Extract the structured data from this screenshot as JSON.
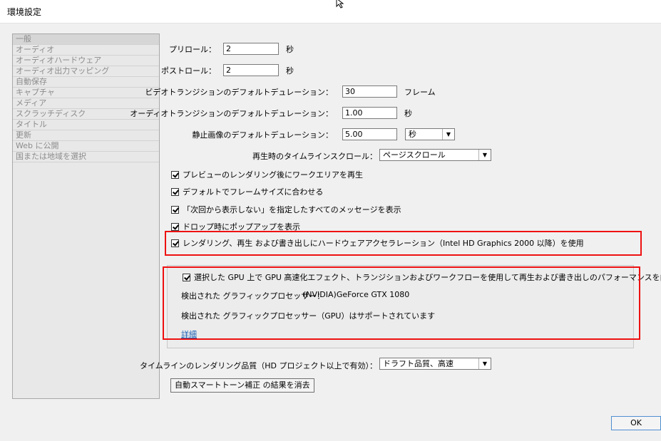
{
  "window": {
    "title": "環境設定"
  },
  "sidebar": {
    "items": [
      {
        "label": "一般",
        "selected": true
      },
      {
        "label": "オーディオ"
      },
      {
        "label": "オーディオハードウェア"
      },
      {
        "label": "オーディオ出力マッピング"
      },
      {
        "label": "自動保存"
      },
      {
        "label": "キャプチャ"
      },
      {
        "label": "メディア"
      },
      {
        "label": "スクラッチディスク"
      },
      {
        "label": "タイトル"
      },
      {
        "label": "更新"
      },
      {
        "label": "Web に公開"
      },
      {
        "label": "国または地域を選択"
      }
    ]
  },
  "general": {
    "preroll": {
      "label": "プリロール：",
      "value": "2",
      "unit": "秒"
    },
    "postroll": {
      "label": "ポストロール：",
      "value": "2",
      "unit": "秒"
    },
    "video_transition": {
      "label": "ビデオトランジションのデフォルトデュレーション：",
      "value": "30",
      "unit": "フレーム"
    },
    "audio_transition": {
      "label": "オーディオトランジションのデフォルトデュレーション：",
      "value": "1.00",
      "unit": "秒"
    },
    "still_image": {
      "label": "静止画像のデフォルトデュレーション：",
      "value": "5.00",
      "unit_select": "秒"
    },
    "timeline_scroll": {
      "label": "再生時のタイムラインスクロール：",
      "value": "ページスクロール"
    },
    "checkboxes": [
      {
        "label": "プレビューのレンダリング後にワークエリアを再生",
        "checked": true
      },
      {
        "label": "デフォルトでフレームサイズに合わせる",
        "checked": true
      },
      {
        "label": "「次回から表示しない」を指定したすべてのメッセージを表示",
        "checked": true
      },
      {
        "label": "ドロップ時にポップアップを表示",
        "checked": true
      },
      {
        "label": "レンダリング、再生 および書き出しにハードウェアアクセラレーション（Intel HD Graphics 2000 以降）を使用",
        "checked": true
      }
    ]
  },
  "gpu": {
    "checkbox_label": "選択した GPU 上で GPU 高速化エフェクト、トランジションおよびワークフローを使用して再生および書き出しのパフォーマンスを向上",
    "detected_label": "検出された グラフィックプロセッサー：",
    "detected_value": "(NVIDIA)GeForce GTX 1080",
    "supported_text": "検出された グラフィックプロセッサー（GPU）はサポートされています",
    "details_link": "詳細"
  },
  "render_quality": {
    "label": "タイムラインのレンダリング品質（HD プロジェクト以上で有効）：",
    "value": "ドラフト品質、高速"
  },
  "buttons": {
    "clear_autotone": "自動スマートトーン補正 の結果を消去",
    "ok": "OK"
  },
  "colors": {
    "highlight": "#ee1111",
    "link": "#1a5fb4"
  }
}
